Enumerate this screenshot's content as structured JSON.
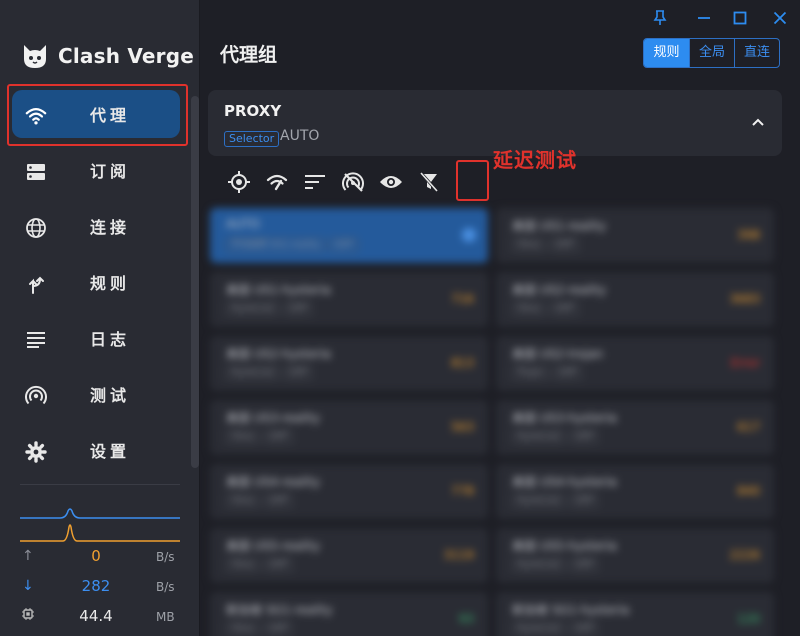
{
  "app": {
    "name": "Clash Verge"
  },
  "sidebar": {
    "items": [
      {
        "label": "代理",
        "icon": "wifi-icon",
        "active": true
      },
      {
        "label": "订阅",
        "icon": "storage-icon"
      },
      {
        "label": "连接",
        "icon": "globe-icon"
      },
      {
        "label": "规则",
        "icon": "fork-icon"
      },
      {
        "label": "日志",
        "icon": "list-icon"
      },
      {
        "label": "测试",
        "icon": "broadcast-icon"
      },
      {
        "label": "设置",
        "icon": "gear-icon"
      }
    ]
  },
  "traffic": {
    "upload": {
      "value": "0",
      "unit": "B/s",
      "color": "#f0a030"
    },
    "download": {
      "value": "282",
      "unit": "B/s",
      "color": "#3c8ef0"
    },
    "memory": {
      "value": "44.4",
      "unit": "MB"
    }
  },
  "main": {
    "title": "代理组",
    "modes": [
      "规则",
      "全局",
      "直连"
    ],
    "active_mode": "规则",
    "group": {
      "name": "PROXY",
      "type": "Selector",
      "now": "AUTO"
    },
    "annotation": "延迟测试",
    "toolbar": [
      "locate-icon",
      "delay-test-icon",
      "sort-icon",
      "hide-unavailable-icon",
      "eye-icon",
      "filter-off-icon"
    ]
  },
  "proxies": [
    {
      "name": "AUTO",
      "tags": [
        "手动选择 SG1-reality",
        "UDP"
      ],
      "delay": "",
      "selected": true
    },
    {
      "name": "美国 US1-reality",
      "tags": [
        "Vless",
        "UDP"
      ],
      "delay": "398"
    },
    {
      "name": "美国 US1-hysteria",
      "tags": [
        "Hysteria2",
        "UDP"
      ],
      "delay": "716"
    },
    {
      "name": "美国 US2-reality",
      "tags": [
        "Vless",
        "UDP"
      ],
      "delay": "3683"
    },
    {
      "name": "美国 US2-hysteria",
      "tags": [
        "Hysteria2",
        "UDP"
      ],
      "delay": "813"
    },
    {
      "name": "美国 US2-trojan",
      "tags": [
        "Trojan",
        "UDP"
      ],
      "delay": "Error"
    },
    {
      "name": "美国 US3-reality",
      "tags": [
        "Vless",
        "UDP"
      ],
      "delay": "563"
    },
    {
      "name": "美国 US3-hysteria",
      "tags": [
        "Hysteria2",
        "UDP"
      ],
      "delay": "617"
    },
    {
      "name": "美国 US4-reality",
      "tags": [
        "Vless",
        "UDP"
      ],
      "delay": "778"
    },
    {
      "name": "美国 US4-hysteria",
      "tags": [
        "Hysteria2",
        "UDP"
      ],
      "delay": "840"
    },
    {
      "name": "美国 US5-reality",
      "tags": [
        "Vless",
        "UDP"
      ],
      "delay": "3119"
    },
    {
      "name": "美国 US5-hysteria",
      "tags": [
        "Hysteria2",
        "UDP"
      ],
      "delay": "2226"
    },
    {
      "name": "新加坡 SG1-reality",
      "tags": [
        "Vless",
        "UDP"
      ],
      "delay": "93"
    },
    {
      "name": "新加坡 SG1-hysteria",
      "tags": [
        "Hysteria2",
        "UDP"
      ],
      "delay": "120"
    }
  ],
  "colors": {
    "accent": "#2d8cf0",
    "highlight": "#e0322c",
    "sidebar_active": "#1b4f86",
    "warn": "#f0a030",
    "error": "#e0322c",
    "good": "#3cb371"
  }
}
